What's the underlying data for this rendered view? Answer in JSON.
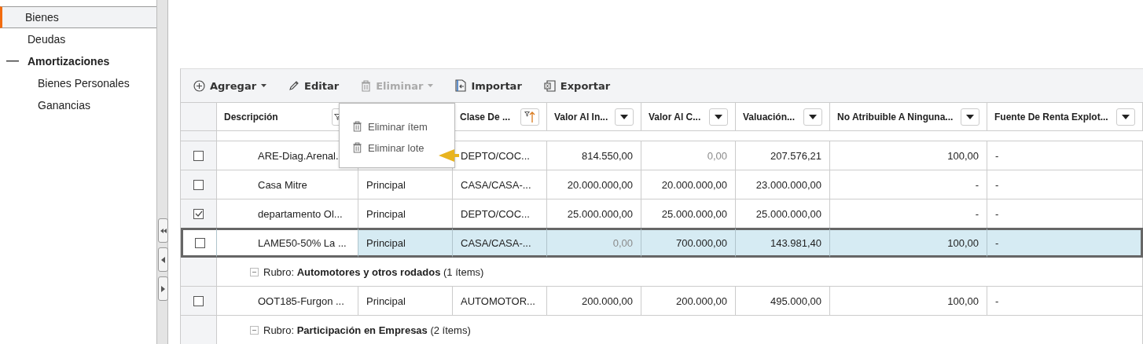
{
  "sidebar": {
    "items": [
      {
        "label": "Bienes",
        "selected": true
      },
      {
        "label": "Deudas",
        "selected": false
      },
      {
        "label": "Amortizaciones",
        "selected": false,
        "expanded": true,
        "children": [
          {
            "label": "Bienes Personales",
            "selected": false
          },
          {
            "label": "Ganancias",
            "selected": false
          }
        ]
      }
    ]
  },
  "toolbar": [
    {
      "label": "Agregar",
      "kind": "add",
      "disabled": false,
      "dropdown": true
    },
    {
      "label": "Editar",
      "kind": "edit",
      "disabled": false,
      "dropdown": false
    },
    {
      "label": "Eliminar",
      "kind": "delete",
      "disabled": true,
      "dropdown": true,
      "expanded": true,
      "menu": [
        "Eliminar ítem",
        "Eliminar lote"
      ]
    },
    {
      "label": "Importar",
      "kind": "import",
      "disabled": false,
      "dropdown": false
    },
    {
      "label": "Exportar",
      "kind": "export",
      "disabled": false,
      "dropdown": false
    }
  ],
  "table": {
    "columns": [
      {
        "label": "Descripción",
        "kind": "filter"
      },
      {
        "kind": "blank"
      },
      {
        "label": "Clase De ...",
        "kind": "sort"
      },
      {
        "label": "Valor Al In...",
        "kind": "dropdown"
      },
      {
        "label": "Valor Al C...",
        "kind": "dropdown"
      },
      {
        "label": "Valuación...",
        "kind": "dropdown"
      },
      {
        "label": "No Atribuible A Ninguna...",
        "kind": "dropdown"
      },
      {
        "label": "Fuente De Renta Explot...",
        "kind": "dropdown"
      }
    ],
    "rows": [
      {
        "kind": "item",
        "checked": false,
        "selected": false,
        "cells": [
          {
            "text": "ARE-Diag.Arenal.",
            "dim": false
          },
          {},
          {
            "text": "DEPTO/COC...",
            "dim": false
          },
          {
            "text": "814.550,00",
            "dim": false
          },
          {
            "text": "0,00",
            "dim": true
          },
          {
            "text": "207.576,21",
            "dim": false
          },
          {
            "text": "100,00",
            "dim": false
          },
          {
            "text": "-",
            "dim": false
          }
        ]
      },
      {
        "kind": "item",
        "checked": false,
        "selected": false,
        "cells": [
          {
            "text": "Casa Mitre",
            "dim": false
          },
          {
            "text": "Principal",
            "dim": false
          },
          {
            "text": "CASA/CASA-...",
            "dim": false
          },
          {
            "text": "20.000.000,00",
            "dim": false
          },
          {
            "text": "20.000.000,00",
            "dim": false
          },
          {
            "text": "23.000.000,00",
            "dim": false
          },
          {
            "text": "-",
            "dim": false
          },
          {
            "text": "-",
            "dim": false
          }
        ]
      },
      {
        "kind": "item",
        "checked": true,
        "selected": false,
        "cells": [
          {
            "text": "departamento Ol...",
            "dim": false
          },
          {
            "text": "Principal",
            "dim": false
          },
          {
            "text": "DEPTO/COC...",
            "dim": false
          },
          {
            "text": "25.000.000,00",
            "dim": false
          },
          {
            "text": "25.000.000,00",
            "dim": false
          },
          {
            "text": "25.000.000,00",
            "dim": false
          },
          {
            "text": "-",
            "dim": false
          },
          {
            "text": "-",
            "dim": false
          }
        ]
      },
      {
        "kind": "item",
        "checked": false,
        "selected": true,
        "cells": [
          {
            "text": "LAME50-50% La ...",
            "dim": false
          },
          {
            "text": "Principal",
            "dim": false
          },
          {
            "text": "CASA/CASA-...",
            "dim": false
          },
          {
            "text": "0,00",
            "dim": true
          },
          {
            "text": "700.000,00",
            "dim": false
          },
          {
            "text": "143.981,40",
            "dim": false
          },
          {
            "text": "100,00",
            "dim": false
          },
          {
            "text": "-",
            "dim": false
          }
        ]
      },
      {
        "kind": "group",
        "expanded": true,
        "label": "Rubro: **Automotores y otros rodados** (1 ítems)"
      },
      {
        "kind": "item",
        "checked": false,
        "selected": false,
        "cells": [
          {
            "text": "OOT185-Furgon ...",
            "dim": false
          },
          {
            "text": "Principal",
            "dim": false
          },
          {
            "text": "AUTOMOTOR...",
            "dim": false
          },
          {
            "text": "200.000,00",
            "dim": false
          },
          {
            "text": "200.000,00",
            "dim": false
          },
          {
            "text": "495.000,00",
            "dim": false
          },
          {
            "text": "100,00",
            "dim": false
          },
          {
            "text": "-",
            "dim": false
          }
        ]
      },
      {
        "kind": "group",
        "expanded": true,
        "label": "Rubro: **Participación en Empresas** (2 ítems)"
      }
    ]
  }
}
